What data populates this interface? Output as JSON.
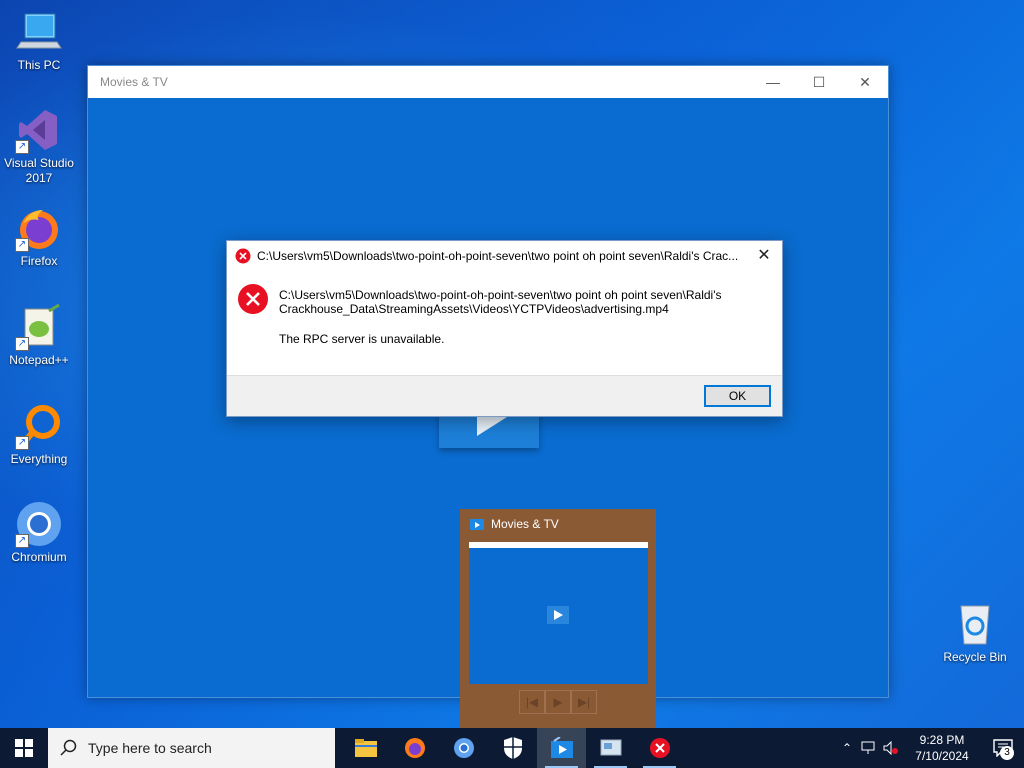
{
  "desktop": {
    "icons": [
      {
        "label": "This PC"
      },
      {
        "label": "Visual Studio 2017"
      },
      {
        "label": "Firefox"
      },
      {
        "label": "Notepad++"
      },
      {
        "label": "Everything"
      },
      {
        "label": "Chromium"
      },
      {
        "label": "Recycle Bin"
      }
    ]
  },
  "app_window": {
    "title": "Movies & TV",
    "controls": {
      "minimize": "—",
      "maximize": "☐",
      "close": "✕"
    }
  },
  "dialog": {
    "title": "C:\\Users\\vm5\\Downloads\\two-point-oh-point-seven\\two point oh point seven\\Raldi's Crac...",
    "close": "✕",
    "message_line1": "C:\\Users\\vm5\\Downloads\\two-point-oh-point-seven\\two point oh point seven\\Raldi's",
    "message_line2": "Crackhouse_Data\\StreamingAssets\\Videos\\YCTPVideos\\advertising.mp4",
    "message_error": "The RPC server is unavailable.",
    "ok_label": "OK"
  },
  "preview": {
    "title": "Movies & TV"
  },
  "taskbar": {
    "search_placeholder": "Type here to search",
    "apps": [
      "file-explorer",
      "firefox",
      "chromium",
      "security",
      "movies-tv",
      "control-panel",
      "error"
    ],
    "time": "9:28 PM",
    "date": "7/10/2024",
    "notification_count": "3"
  },
  "colors": {
    "accent": "#0078d7",
    "app_bg": "#0a6cd0",
    "error_red": "#e81123",
    "preview_bg": "#8a5a35",
    "taskbar_bg": "#0c1a33"
  }
}
